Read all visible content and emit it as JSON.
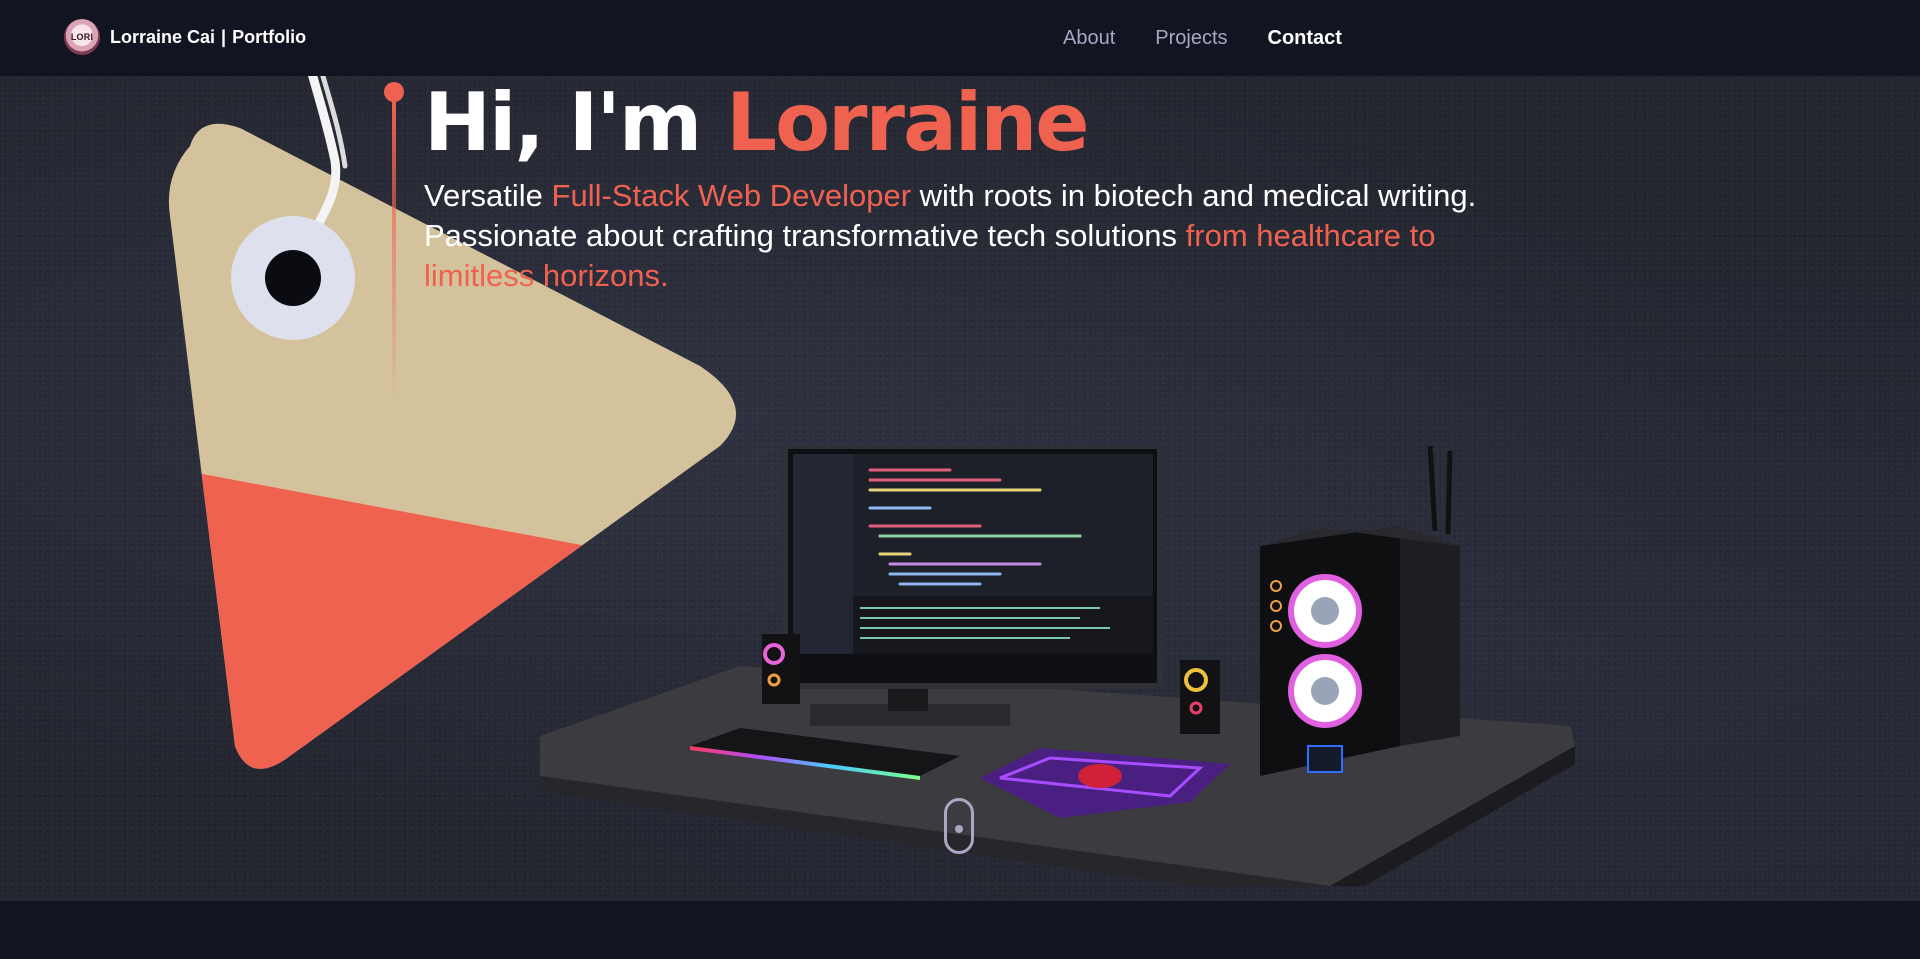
{
  "nav": {
    "logo_text": "LORI",
    "brand_name": "Lorraine Cai",
    "brand_sep": "|",
    "brand_sub": "Portfolio",
    "links": [
      {
        "label": "About",
        "active": false
      },
      {
        "label": "Projects",
        "active": false
      },
      {
        "label": "Contact",
        "active": true
      }
    ]
  },
  "hero": {
    "greeting": "Hi, I'm ",
    "name": "Lorraine",
    "intro_1": "Versatile ",
    "role": "Full-Stack Web Developer",
    "intro_2": " with roots in biotech and medical writing. Passionate about crafting transformative tech solutions ",
    "tagline": "from healthcare to limitless horizons."
  },
  "colors": {
    "accent": "#f06250",
    "nav_bg": "#121421",
    "link_inactive": "#aaa6c3",
    "text": "#ffffff"
  },
  "icons": {
    "scroll": "mouse-scroll-icon",
    "logo": "avatar-logo-icon"
  }
}
